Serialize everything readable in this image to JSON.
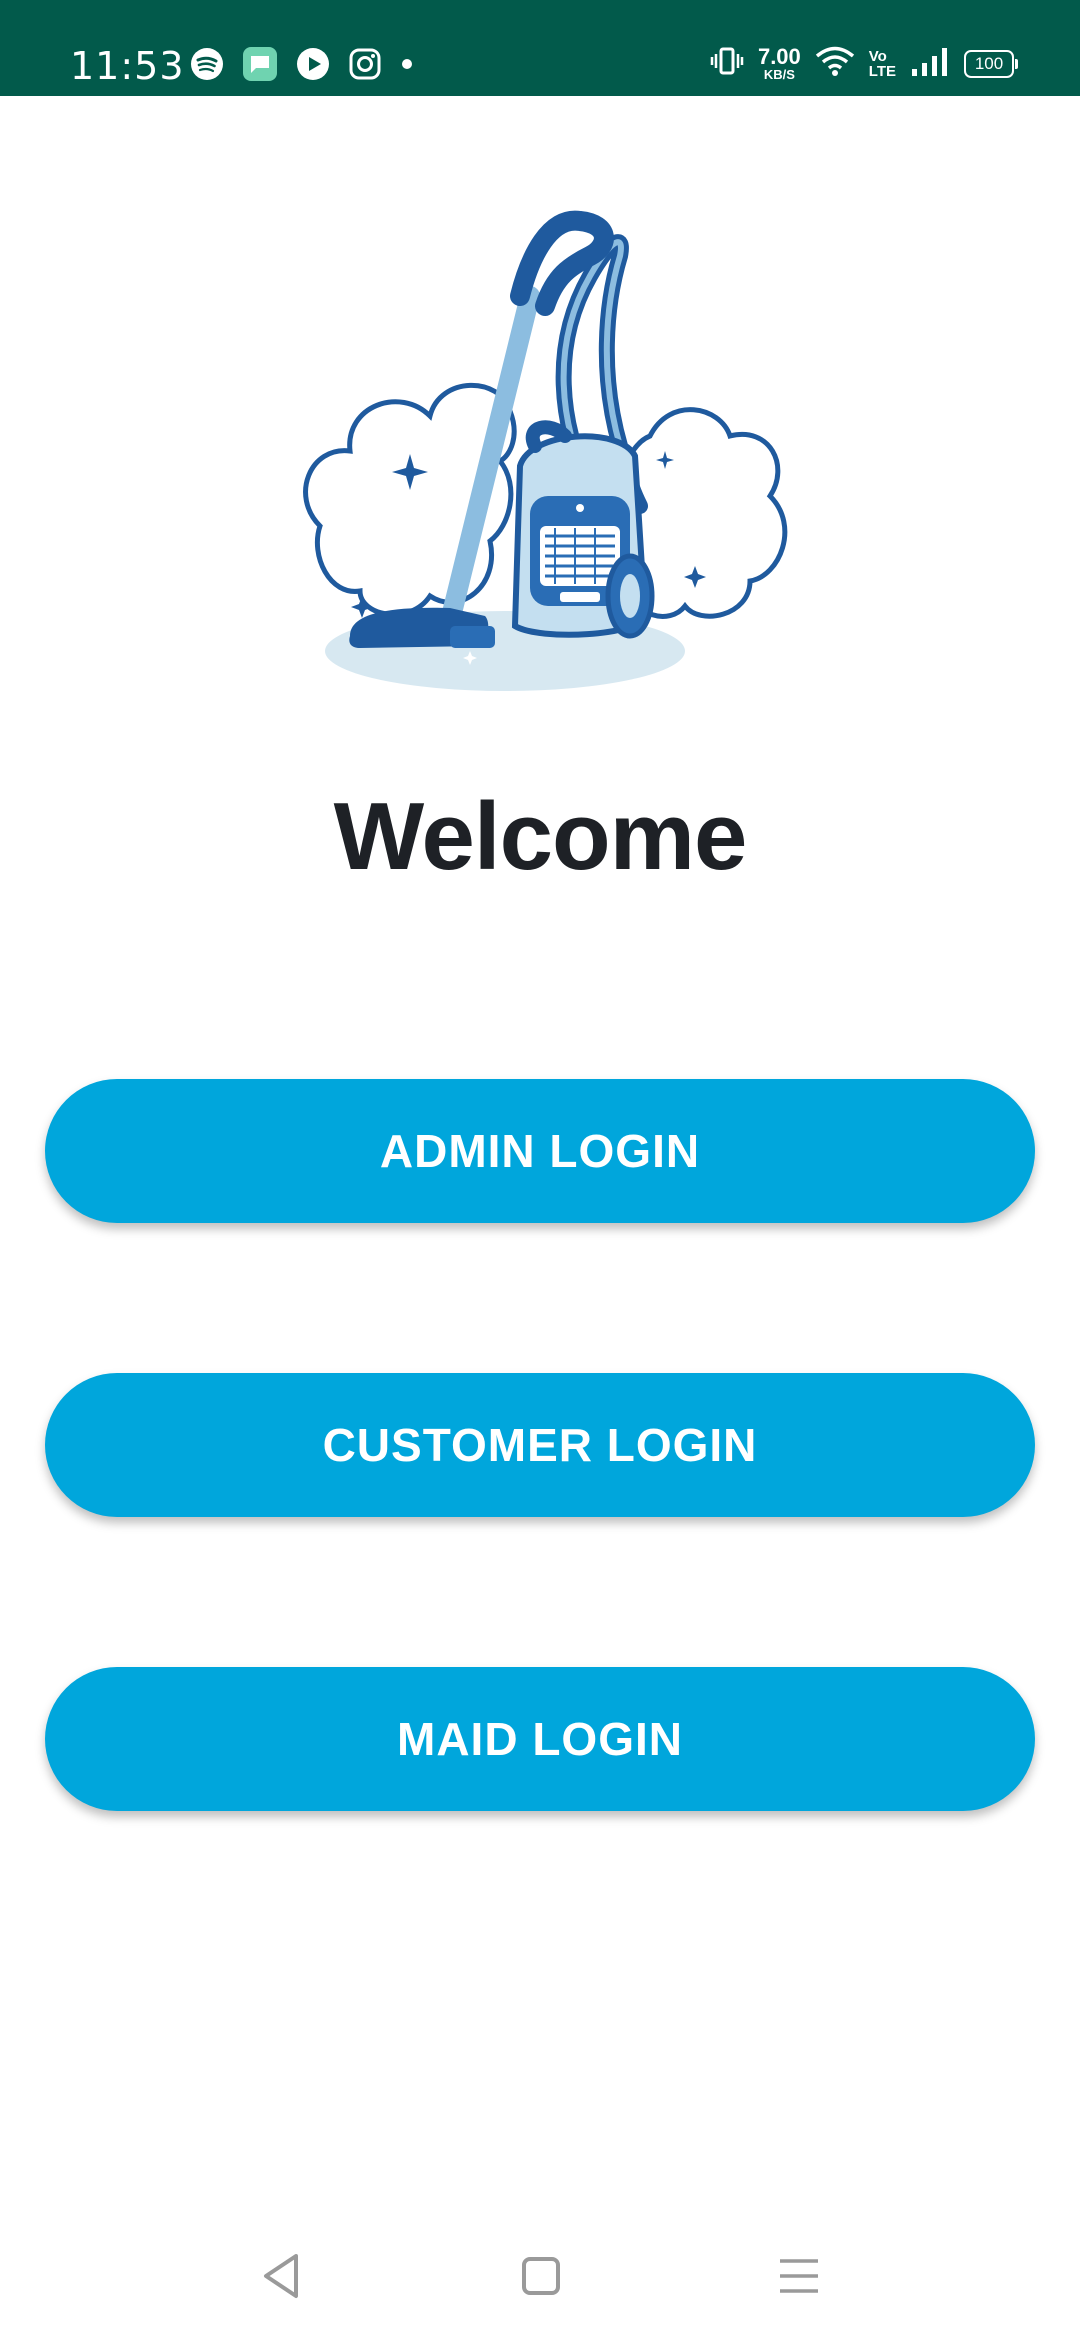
{
  "status_bar": {
    "time": "11:53",
    "speed_value": "7.00",
    "speed_unit": "KB/S",
    "volte_top": "Vo",
    "volte_bottom": "LTE",
    "battery": "100",
    "icons": [
      "spotify-icon",
      "messages-icon",
      "youtube-music-icon",
      "instagram-icon",
      "more-notifications-dot",
      "vibrate-icon",
      "wifi-icon",
      "signal-icon",
      "battery-icon"
    ]
  },
  "main": {
    "title": "Welcome",
    "buttons": {
      "admin": "ADMIN LOGIN",
      "customer": "CUSTOMER LOGIN",
      "maid": "MAID LOGIN"
    }
  },
  "nav": {
    "icons": [
      "back-icon",
      "home-icon",
      "recents-menu-icon"
    ]
  },
  "colors": {
    "status_bar": "#025a4b",
    "button": "#00a6dc",
    "title": "#1e2126",
    "illustration_dark": "#1f5a9e",
    "illustration_light": "#8cbde0"
  }
}
